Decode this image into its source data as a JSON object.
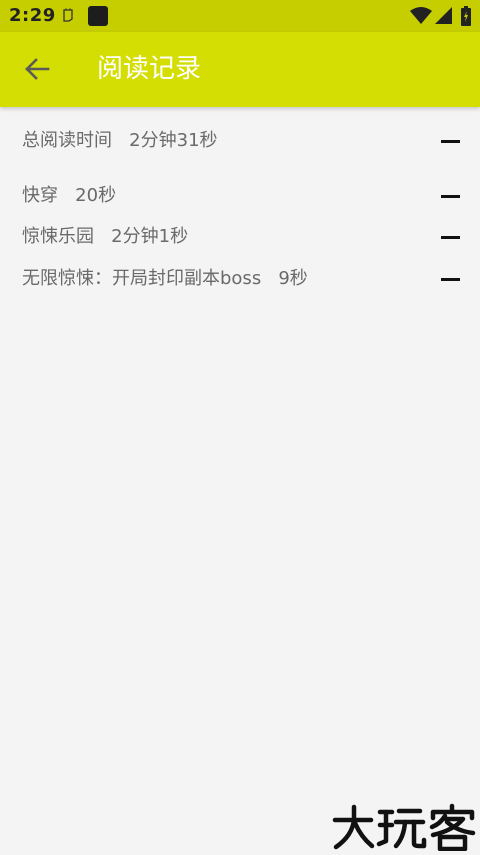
{
  "status_bar": {
    "time": "2:29",
    "icons": [
      "notification-icon",
      "app-icon",
      "wifi-icon",
      "signal-icon",
      "battery-icon"
    ]
  },
  "app_bar": {
    "title": "阅读记录",
    "back_icon": "arrow-left-icon"
  },
  "total": {
    "text": "总阅读时间   2分钟31秒"
  },
  "records": [
    {
      "text": "快穿   20秒"
    },
    {
      "text": "惊悚乐园   2分钟1秒"
    },
    {
      "text": "无限惊悚：开局封印副本boss   9秒"
    }
  ],
  "watermark": {
    "text": "大玩客"
  },
  "colors": {
    "status_bar": "#c6ce00",
    "app_bar": "#d4de03",
    "background": "#f4f4f4",
    "row_text": "#6a6a6a",
    "title_text": "#ffffff"
  }
}
